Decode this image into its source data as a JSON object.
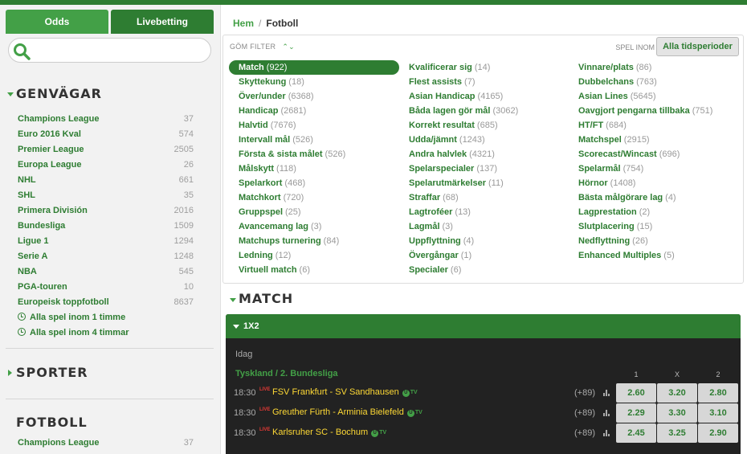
{
  "tabs": {
    "odds": "Odds",
    "live": "Livebetting"
  },
  "search": {
    "placeholder": ""
  },
  "genvagar": {
    "title": "GENVÄGAR",
    "items": [
      {
        "label": "Champions League",
        "count": "37"
      },
      {
        "label": "Euro 2016 Kval",
        "count": "574"
      },
      {
        "label": "Premier League",
        "count": "2505"
      },
      {
        "label": "Europa League",
        "count": "26"
      },
      {
        "label": "NHL",
        "count": "661"
      },
      {
        "label": "SHL",
        "count": "35"
      },
      {
        "label": "Primera División",
        "count": "2016"
      },
      {
        "label": "Bundesliga",
        "count": "1509"
      },
      {
        "label": "Ligue 1",
        "count": "1294"
      },
      {
        "label": "Serie A",
        "count": "1248"
      },
      {
        "label": "NBA",
        "count": "545"
      },
      {
        "label": "PGA-touren",
        "count": "10"
      },
      {
        "label": "Europeisk toppfotboll",
        "count": "8637"
      }
    ],
    "time_links": [
      "Alla spel inom 1 timme",
      "Alla spel inom 4 timmar"
    ]
  },
  "sporter": {
    "title": "SPORTER"
  },
  "fotboll": {
    "title": "FOTBOLL",
    "items": [
      {
        "label": "Champions League",
        "count": "37"
      }
    ]
  },
  "breadcrumb": {
    "home": "Hem",
    "sep": "/",
    "current": "Fotboll"
  },
  "filter": {
    "hide_label": "GÖM FILTER",
    "caret": "⌃⌄",
    "period_label": "SPEL INOM",
    "period_button": "Alla tidsperioder",
    "col1": [
      {
        "label": "Match",
        "count": "(922)",
        "selected": true
      },
      {
        "label": "Skyttekung",
        "count": "(18)"
      },
      {
        "label": "Över/under",
        "count": "(6368)"
      },
      {
        "label": "Handicap",
        "count": "(2681)"
      },
      {
        "label": "Halvtid",
        "count": "(7676)"
      },
      {
        "label": "Intervall mål",
        "count": "(526)"
      },
      {
        "label": "Första & sista målet",
        "count": "(526)"
      },
      {
        "label": "Målskytt",
        "count": "(118)"
      },
      {
        "label": "Spelarkort",
        "count": "(468)"
      },
      {
        "label": "Matchkort",
        "count": "(720)"
      },
      {
        "label": "Gruppspel",
        "count": "(25)"
      },
      {
        "label": "Avancemang lag",
        "count": "(3)"
      },
      {
        "label": "Matchups turnering",
        "count": "(84)"
      },
      {
        "label": "Ledning",
        "count": "(12)"
      },
      {
        "label": "Virtuell match",
        "count": "(6)"
      }
    ],
    "col2": [
      {
        "label": "Kvalificerar sig",
        "count": "(14)"
      },
      {
        "label": "Flest assists",
        "count": "(7)"
      },
      {
        "label": "Asian Handicap",
        "count": "(4165)"
      },
      {
        "label": "Båda lagen gör mål",
        "count": "(3062)"
      },
      {
        "label": "Korrekt resultat",
        "count": "(685)"
      },
      {
        "label": "Udda/jämnt",
        "count": "(1243)"
      },
      {
        "label": "Andra halvlek",
        "count": "(4321)"
      },
      {
        "label": "Spelarspecialer",
        "count": "(137)"
      },
      {
        "label": "Spelarutmärkelser",
        "count": "(11)"
      },
      {
        "label": "Straffar",
        "count": "(68)"
      },
      {
        "label": "Lagtroféer",
        "count": "(13)"
      },
      {
        "label": "Lagmål",
        "count": "(3)"
      },
      {
        "label": "Uppflyttning",
        "count": "(4)"
      },
      {
        "label": "Övergångar",
        "count": "(1)"
      },
      {
        "label": "Specialer",
        "count": "(6)"
      }
    ],
    "col3": [
      {
        "label": "Vinnare/plats",
        "count": "(86)"
      },
      {
        "label": "Dubbelchans",
        "count": "(763)"
      },
      {
        "label": "Asian Lines",
        "count": "(5645)"
      },
      {
        "label": "Oavgjort pengarna tillbaka",
        "count": "(751)"
      },
      {
        "label": "HT/FT",
        "count": "(684)"
      },
      {
        "label": "Matchspel",
        "count": "(2915)"
      },
      {
        "label": "Scorecast/Wincast",
        "count": "(696)"
      },
      {
        "label": "Spelarmål",
        "count": "(754)"
      },
      {
        "label": "Hörnor",
        "count": "(1408)"
      },
      {
        "label": "Bästa målgörare lag",
        "count": "(4)"
      },
      {
        "label": "Lagprestation",
        "count": "(2)"
      },
      {
        "label": "Slutplacering",
        "count": "(15)"
      },
      {
        "label": "Nedflyttning",
        "count": "(26)"
      },
      {
        "label": "Enhanced Multiples",
        "count": "(5)"
      }
    ]
  },
  "match": {
    "title": "MATCH",
    "board_title": "1X2",
    "today": "Idag",
    "league": "Tyskland / 2. Bundesliga",
    "odds_headers": [
      "1",
      "X",
      "2"
    ],
    "live_label": "LIVE",
    "tv_label": "TV",
    "tv_mark": "U",
    "events": [
      {
        "time": "18:30",
        "teams": "FSV Frankfurt  -  SV Sandhausen",
        "more": "(+89)",
        "odds": [
          "2.60",
          "3.20",
          "2.80"
        ]
      },
      {
        "time": "18:30",
        "teams": "Greuther Fürth  -  Arminia Bielefeld",
        "more": "(+89)",
        "odds": [
          "2.29",
          "3.30",
          "3.10"
        ]
      },
      {
        "time": "18:30",
        "teams": "Karlsruher SC  -  Bochum",
        "more": "(+89)",
        "odds": [
          "2.45",
          "3.25",
          "2.90"
        ]
      }
    ]
  }
}
